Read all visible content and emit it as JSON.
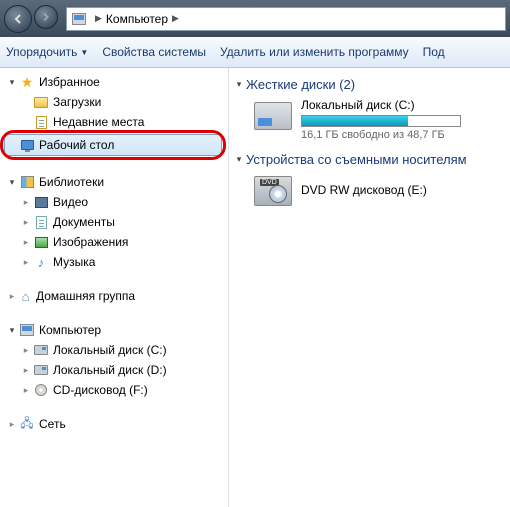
{
  "titlebar": {
    "address_root": "Компьютер"
  },
  "toolbar": {
    "organize": "Упорядочить",
    "properties": "Свойства системы",
    "uninstall": "Удалить или изменить программу",
    "more": "Под"
  },
  "sidebar": {
    "favorites": {
      "label": "Избранное",
      "downloads": "Загрузки",
      "recent": "Недавние места",
      "desktop": "Рабочий стол"
    },
    "libraries": {
      "label": "Библиотеки",
      "video": "Видео",
      "documents": "Документы",
      "pictures": "Изображения",
      "music": "Музыка"
    },
    "homegroup": "Домашняя группа",
    "computer": {
      "label": "Компьютер",
      "disk_c": "Локальный диск (C:)",
      "disk_d": "Локальный диск (D:)",
      "cd_f": "CD-дисковод (F:)"
    },
    "network": "Сеть"
  },
  "main": {
    "hdd_header": "Жесткие диски (2)",
    "drive_c": {
      "name": "Локальный диск (C:)",
      "status": "16,1 ГБ свободно из 48,7 ГБ",
      "fill_pct": 67
    },
    "removable_header": "Устройства со съемными носителям",
    "dvd": {
      "name": "DVD RW дисковод (E:)"
    }
  }
}
